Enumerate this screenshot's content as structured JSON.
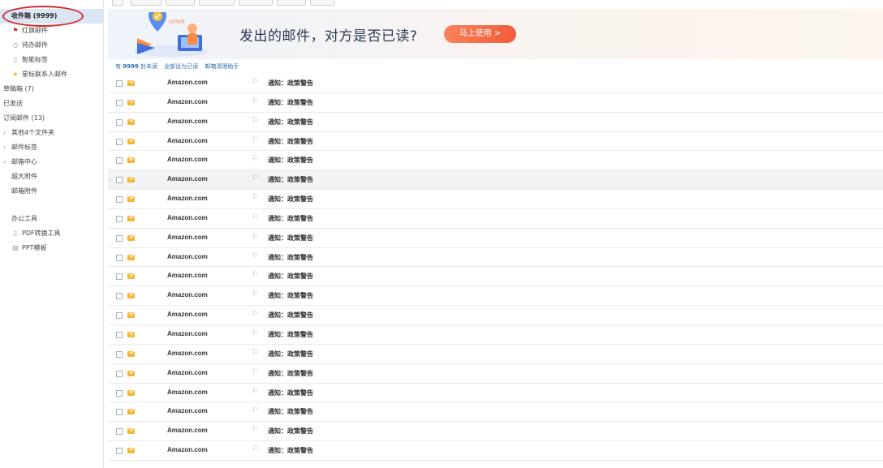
{
  "sidebar": {
    "inbox_label": "收件箱 (9999)",
    "items": [
      {
        "label": "红旗邮件",
        "icon": "red-flag-icon"
      },
      {
        "label": "待办邮件",
        "icon": "clock-icon"
      },
      {
        "label": "智能标签",
        "icon": "tag-icon"
      },
      {
        "label": "星标联系人邮件",
        "icon": "star-icon"
      }
    ],
    "folders": [
      {
        "label": "草稿箱 (7)"
      },
      {
        "label": "已发送"
      },
      {
        "label": "订阅邮件 (13)"
      }
    ],
    "groups": [
      {
        "label": "其他4个文件夹"
      },
      {
        "label": "邮件标签"
      },
      {
        "label": "邮箱中心"
      }
    ],
    "extras": [
      {
        "label": "超大附件"
      },
      {
        "label": "邮箱附件"
      }
    ],
    "tools_header": "办公工具",
    "tools": [
      {
        "label": "PDF转换工具",
        "icon": "pdf-icon"
      },
      {
        "label": "PPT模板",
        "icon": "ppt-icon"
      }
    ]
  },
  "banner": {
    "headline": "发出的邮件，对方是否已读?",
    "cta": "马上使用 >",
    "art_label": "OFFER"
  },
  "info": {
    "prefix": "有",
    "count": "9999",
    "suffix": "封未读",
    "links": [
      "全部设为已读",
      "邮箱清理助手"
    ]
  },
  "mails": [
    {
      "sender": "Amazon.com",
      "subject": "通知：政策警告"
    },
    {
      "sender": "Amazon.com",
      "subject": "通知：政策警告"
    },
    {
      "sender": "Amazon.com",
      "subject": "通知：政策警告"
    },
    {
      "sender": "Amazon.com",
      "subject": "通知：政策警告"
    },
    {
      "sender": "Amazon.com",
      "subject": "通知：政策警告"
    },
    {
      "sender": "Amazon.com",
      "subject": "通知：政策警告"
    },
    {
      "sender": "Amazon.com",
      "subject": "通知：政策警告"
    },
    {
      "sender": "Amazon.com",
      "subject": "通知：政策警告"
    },
    {
      "sender": "Amazon.com",
      "subject": "通知：政策警告"
    },
    {
      "sender": "Amazon.com",
      "subject": "通知：政策警告"
    },
    {
      "sender": "Amazon.com",
      "subject": "通知：政策警告"
    },
    {
      "sender": "Amazon.com",
      "subject": "通知：政策警告"
    },
    {
      "sender": "Amazon.com",
      "subject": "通知：政策警告"
    },
    {
      "sender": "Amazon.com",
      "subject": "通知：政策警告"
    },
    {
      "sender": "Amazon.com",
      "subject": "通知：政策警告"
    },
    {
      "sender": "Amazon.com",
      "subject": "通知：政策警告"
    },
    {
      "sender": "Amazon.com",
      "subject": "通知：政策警告"
    },
    {
      "sender": "Amazon.com",
      "subject": "通知：政策警告"
    },
    {
      "sender": "Amazon.com",
      "subject": "通知：政策警告"
    },
    {
      "sender": "Amazon.com",
      "subject": "通知：政策警告"
    }
  ],
  "highlighted_row": 5,
  "colors": {
    "accent": "#2f6fb5",
    "cta": "#f25c3b",
    "annotation": "#d62a2a",
    "mail_icon": "#f2b638"
  }
}
